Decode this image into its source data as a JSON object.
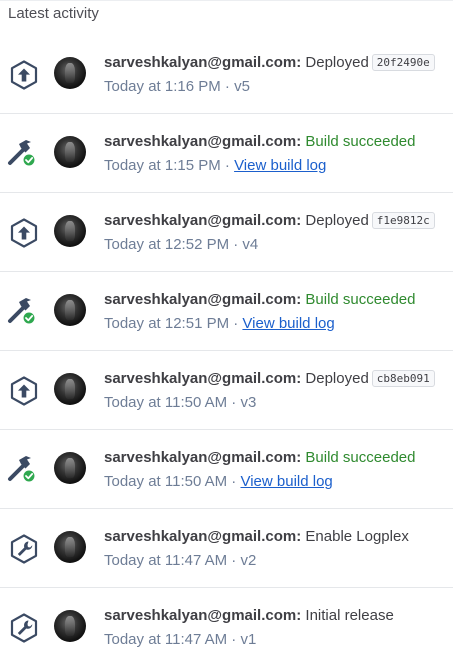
{
  "header": {
    "title": "Latest activity"
  },
  "separator": "·",
  "items": [
    {
      "kind": "deploy",
      "icon": "deploy-icon",
      "user": "sarveshkalyan@gmail.com:",
      "action": "Deployed",
      "hash": "20f2490e",
      "time": "Today at 1:16 PM",
      "version": "v5"
    },
    {
      "kind": "build",
      "icon": "build-succeeded-icon",
      "user": "sarveshkalyan@gmail.com:",
      "action": "Build succeeded",
      "time": "Today at 1:15 PM",
      "link": "View build log"
    },
    {
      "kind": "deploy",
      "icon": "deploy-icon",
      "user": "sarveshkalyan@gmail.com:",
      "action": "Deployed",
      "hash": "f1e9812c",
      "time": "Today at 12:52 PM",
      "version": "v4"
    },
    {
      "kind": "build",
      "icon": "build-succeeded-icon",
      "user": "sarveshkalyan@gmail.com:",
      "action": "Build succeeded",
      "time": "Today at 12:51 PM",
      "link": "View build log"
    },
    {
      "kind": "deploy",
      "icon": "deploy-icon",
      "user": "sarveshkalyan@gmail.com:",
      "action": "Deployed",
      "hash": "cb8eb091",
      "time": "Today at 11:50 AM",
      "version": "v3"
    },
    {
      "kind": "build",
      "icon": "build-succeeded-icon",
      "user": "sarveshkalyan@gmail.com:",
      "action": "Build succeeded",
      "time": "Today at 11:50 AM",
      "link": "View build log"
    },
    {
      "kind": "config",
      "icon": "wrench-icon",
      "user": "sarveshkalyan@gmail.com:",
      "action": "Enable Logplex",
      "time": "Today at 11:47 AM",
      "version": "v2"
    },
    {
      "kind": "config",
      "icon": "wrench-icon",
      "user": "sarveshkalyan@gmail.com:",
      "action": "Initial release",
      "time": "Today at 11:47 AM",
      "version": "v1"
    }
  ],
  "colors": {
    "success": "#2f8a2f",
    "link": "#1b5fcc",
    "icon": "#3b4a63",
    "badge": "#2fa84f"
  }
}
